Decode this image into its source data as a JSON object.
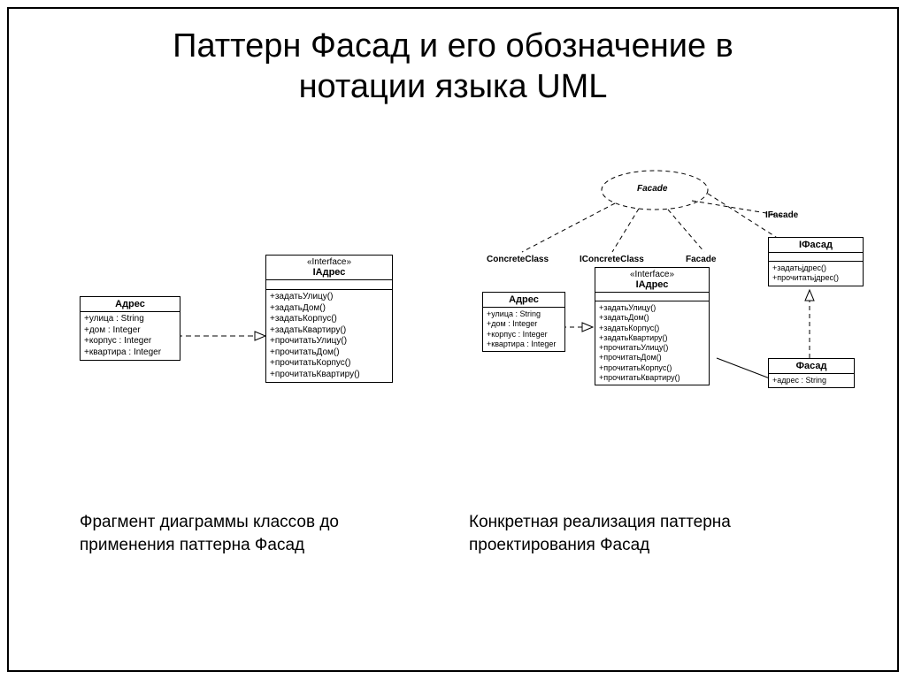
{
  "title_line1": "Паттерн Фасад и его обозначение в",
  "title_line2": "нотации языка UML",
  "caption_left": "Фрагмент диаграммы классов до применения паттерна Фасад",
  "caption_right": "Конкретная реализация паттерна проектирования Фасад",
  "labels": {
    "facade_cloud": "Facade",
    "ifacade": "IFacade",
    "concrete_class": "ConcreteClass",
    "iconcrete_class": "IConcreteClass",
    "facade": "Facade"
  },
  "left": {
    "adres_name": "Адрес",
    "adres_attrs": "+улица : String\n+дом : Integer\n+корпус : Integer\n+квартира : Integer",
    "iadres_stereotype": "«Interface»",
    "iadres_name": "IАдрес",
    "iadres_ops": "+задатьУлицу()\n+задатьДом()\n+задатьКорпус()\n+задатьКвартиру()\n+прочитатьУлицу()\n+прочитатьДом()\n+прочитатьКорпус()\n+прочитатьКвартиру()"
  },
  "right": {
    "adres_name": "Адрес",
    "adres_attrs": "+улица : String\n+дом : Integer\n+корпус : Integer\n+квартира : Integer",
    "iadres_stereotype": "«Interface»",
    "iadres_name": "IАдрес",
    "iadres_ops": "+задатьУлицу()\n+задатьДом()\n+задатьКорпус()\n+задатьКвартиру()\n+прочитатьУлицу()\n+прочитатьДом()\n+прочитатьКорпус()\n+прочитатьКвартиру()",
    "ifacade_name": "IФасад",
    "ifacade_ops": "+задатьjдрес()\n+прочитатьjдрес()",
    "facade_name": "Фасад",
    "facade_attrs": "+адрес : String"
  }
}
